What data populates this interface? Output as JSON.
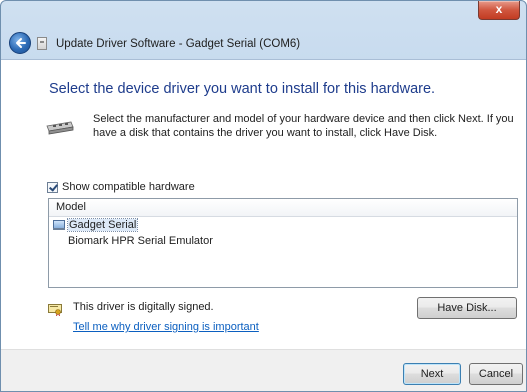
{
  "window": {
    "title": "Update Driver Software - Gadget Serial (COM6)",
    "close_label": "x"
  },
  "content": {
    "heading": "Select the device driver you want to install for this hardware.",
    "instructions": "Select the manufacturer and model of your hardware device and then click Next. If you have a disk that contains the driver you want to install, click Have Disk."
  },
  "compatible": {
    "label": "Show compatible hardware",
    "checked": true
  },
  "model_list": {
    "header": "Model",
    "items": [
      {
        "label": "Gadget Serial",
        "selected": true,
        "icon": "serial-port-icon"
      },
      {
        "label": "Biomark HPR Serial Emulator",
        "selected": false
      }
    ]
  },
  "signing": {
    "status": "This driver is digitally signed.",
    "link": "Tell me why driver signing is important",
    "icon": "signed-driver-icon"
  },
  "buttons": {
    "have_disk": "Have Disk...",
    "next": "Next",
    "cancel": "Cancel"
  },
  "colors": {
    "heading": "#1e3c8c",
    "link": "#0b5fc0",
    "titlebar": "#bcd3ea",
    "close_button": "#c23b22"
  }
}
